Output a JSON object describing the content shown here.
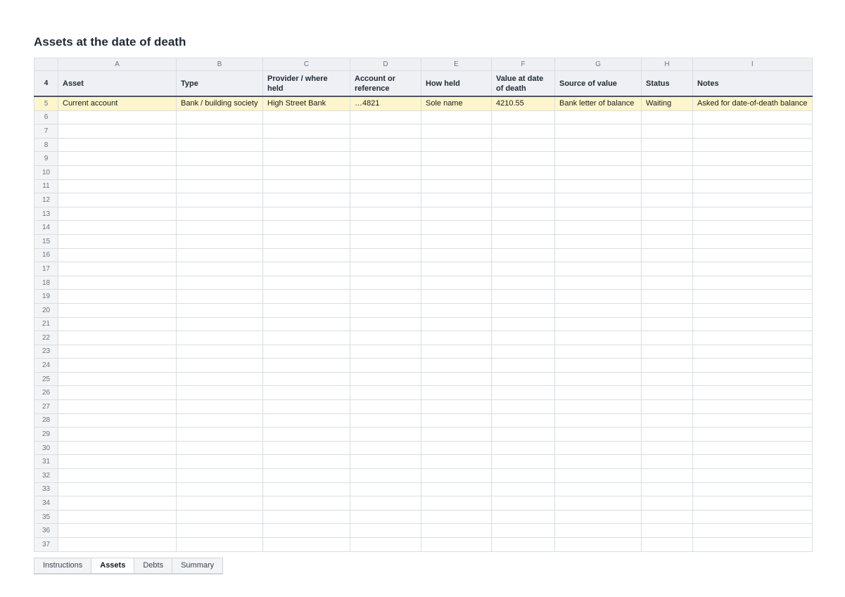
{
  "page_title": "Assets at the date of death",
  "column_letters": [
    "A",
    "B",
    "C",
    "D",
    "E",
    "F",
    "G",
    "H",
    "I"
  ],
  "header_row_number": "4",
  "headers": [
    "Asset",
    "Type",
    "Provider / where held",
    "Account or reference",
    "How held",
    "Value at date of death",
    "Source of value",
    "Status",
    "Notes"
  ],
  "rows": [
    {
      "num": "5",
      "cells": [
        "Current account",
        "Bank / building society",
        "High Street Bank",
        "…4821",
        "Sole name",
        "4210.55",
        "Bank letter of balance",
        "Waiting",
        "Asked for date-of-death balance"
      ]
    },
    {
      "num": "6",
      "cells": [
        "",
        "",
        "",
        "",
        "",
        "",
        "",
        "",
        ""
      ]
    },
    {
      "num": "7",
      "cells": [
        "",
        "",
        "",
        "",
        "",
        "",
        "",
        "",
        ""
      ]
    },
    {
      "num": "8",
      "cells": [
        "",
        "",
        "",
        "",
        "",
        "",
        "",
        "",
        ""
      ]
    },
    {
      "num": "9",
      "cells": [
        "",
        "",
        "",
        "",
        "",
        "",
        "",
        "",
        ""
      ]
    },
    {
      "num": "10",
      "cells": [
        "",
        "",
        "",
        "",
        "",
        "",
        "",
        "",
        ""
      ]
    },
    {
      "num": "11",
      "cells": [
        "",
        "",
        "",
        "",
        "",
        "",
        "",
        "",
        ""
      ]
    },
    {
      "num": "12",
      "cells": [
        "",
        "",
        "",
        "",
        "",
        "",
        "",
        "",
        ""
      ]
    },
    {
      "num": "13",
      "cells": [
        "",
        "",
        "",
        "",
        "",
        "",
        "",
        "",
        ""
      ]
    },
    {
      "num": "14",
      "cells": [
        "",
        "",
        "",
        "",
        "",
        "",
        "",
        "",
        ""
      ]
    },
    {
      "num": "15",
      "cells": [
        "",
        "",
        "",
        "",
        "",
        "",
        "",
        "",
        ""
      ]
    },
    {
      "num": "16",
      "cells": [
        "",
        "",
        "",
        "",
        "",
        "",
        "",
        "",
        ""
      ]
    },
    {
      "num": "17",
      "cells": [
        "",
        "",
        "",
        "",
        "",
        "",
        "",
        "",
        ""
      ]
    },
    {
      "num": "18",
      "cells": [
        "",
        "",
        "",
        "",
        "",
        "",
        "",
        "",
        ""
      ]
    },
    {
      "num": "19",
      "cells": [
        "",
        "",
        "",
        "",
        "",
        "",
        "",
        "",
        ""
      ]
    },
    {
      "num": "20",
      "cells": [
        "",
        "",
        "",
        "",
        "",
        "",
        "",
        "",
        ""
      ]
    },
    {
      "num": "21",
      "cells": [
        "",
        "",
        "",
        "",
        "",
        "",
        "",
        "",
        ""
      ]
    },
    {
      "num": "22",
      "cells": [
        "",
        "",
        "",
        "",
        "",
        "",
        "",
        "",
        ""
      ]
    },
    {
      "num": "23",
      "cells": [
        "",
        "",
        "",
        "",
        "",
        "",
        "",
        "",
        ""
      ]
    },
    {
      "num": "24",
      "cells": [
        "",
        "",
        "",
        "",
        "",
        "",
        "",
        "",
        ""
      ]
    },
    {
      "num": "25",
      "cells": [
        "",
        "",
        "",
        "",
        "",
        "",
        "",
        "",
        ""
      ]
    },
    {
      "num": "26",
      "cells": [
        "",
        "",
        "",
        "",
        "",
        "",
        "",
        "",
        ""
      ]
    },
    {
      "num": "27",
      "cells": [
        "",
        "",
        "",
        "",
        "",
        "",
        "",
        "",
        ""
      ]
    },
    {
      "num": "28",
      "cells": [
        "",
        "",
        "",
        "",
        "",
        "",
        "",
        "",
        ""
      ]
    },
    {
      "num": "29",
      "cells": [
        "",
        "",
        "",
        "",
        "",
        "",
        "",
        "",
        ""
      ]
    },
    {
      "num": "30",
      "cells": [
        "",
        "",
        "",
        "",
        "",
        "",
        "",
        "",
        ""
      ]
    },
    {
      "num": "31",
      "cells": [
        "",
        "",
        "",
        "",
        "",
        "",
        "",
        "",
        ""
      ]
    },
    {
      "num": "32",
      "cells": [
        "",
        "",
        "",
        "",
        "",
        "",
        "",
        "",
        ""
      ]
    },
    {
      "num": "33",
      "cells": [
        "",
        "",
        "",
        "",
        "",
        "",
        "",
        "",
        ""
      ]
    },
    {
      "num": "34",
      "cells": [
        "",
        "",
        "",
        "",
        "",
        "",
        "",
        "",
        ""
      ]
    },
    {
      "num": "35",
      "cells": [
        "",
        "",
        "",
        "",
        "",
        "",
        "",
        "",
        ""
      ]
    },
    {
      "num": "36",
      "cells": [
        "",
        "",
        "",
        "",
        "",
        "",
        "",
        "",
        ""
      ]
    },
    {
      "num": "37",
      "cells": [
        "",
        "",
        "",
        "",
        "",
        "",
        "",
        "",
        ""
      ]
    }
  ],
  "highlight_color": "#fdf6cc",
  "tabs": [
    {
      "label": "Instructions",
      "active": false
    },
    {
      "label": "Assets",
      "active": true
    },
    {
      "label": "Debts",
      "active": false
    },
    {
      "label": "Summary",
      "active": false
    }
  ]
}
